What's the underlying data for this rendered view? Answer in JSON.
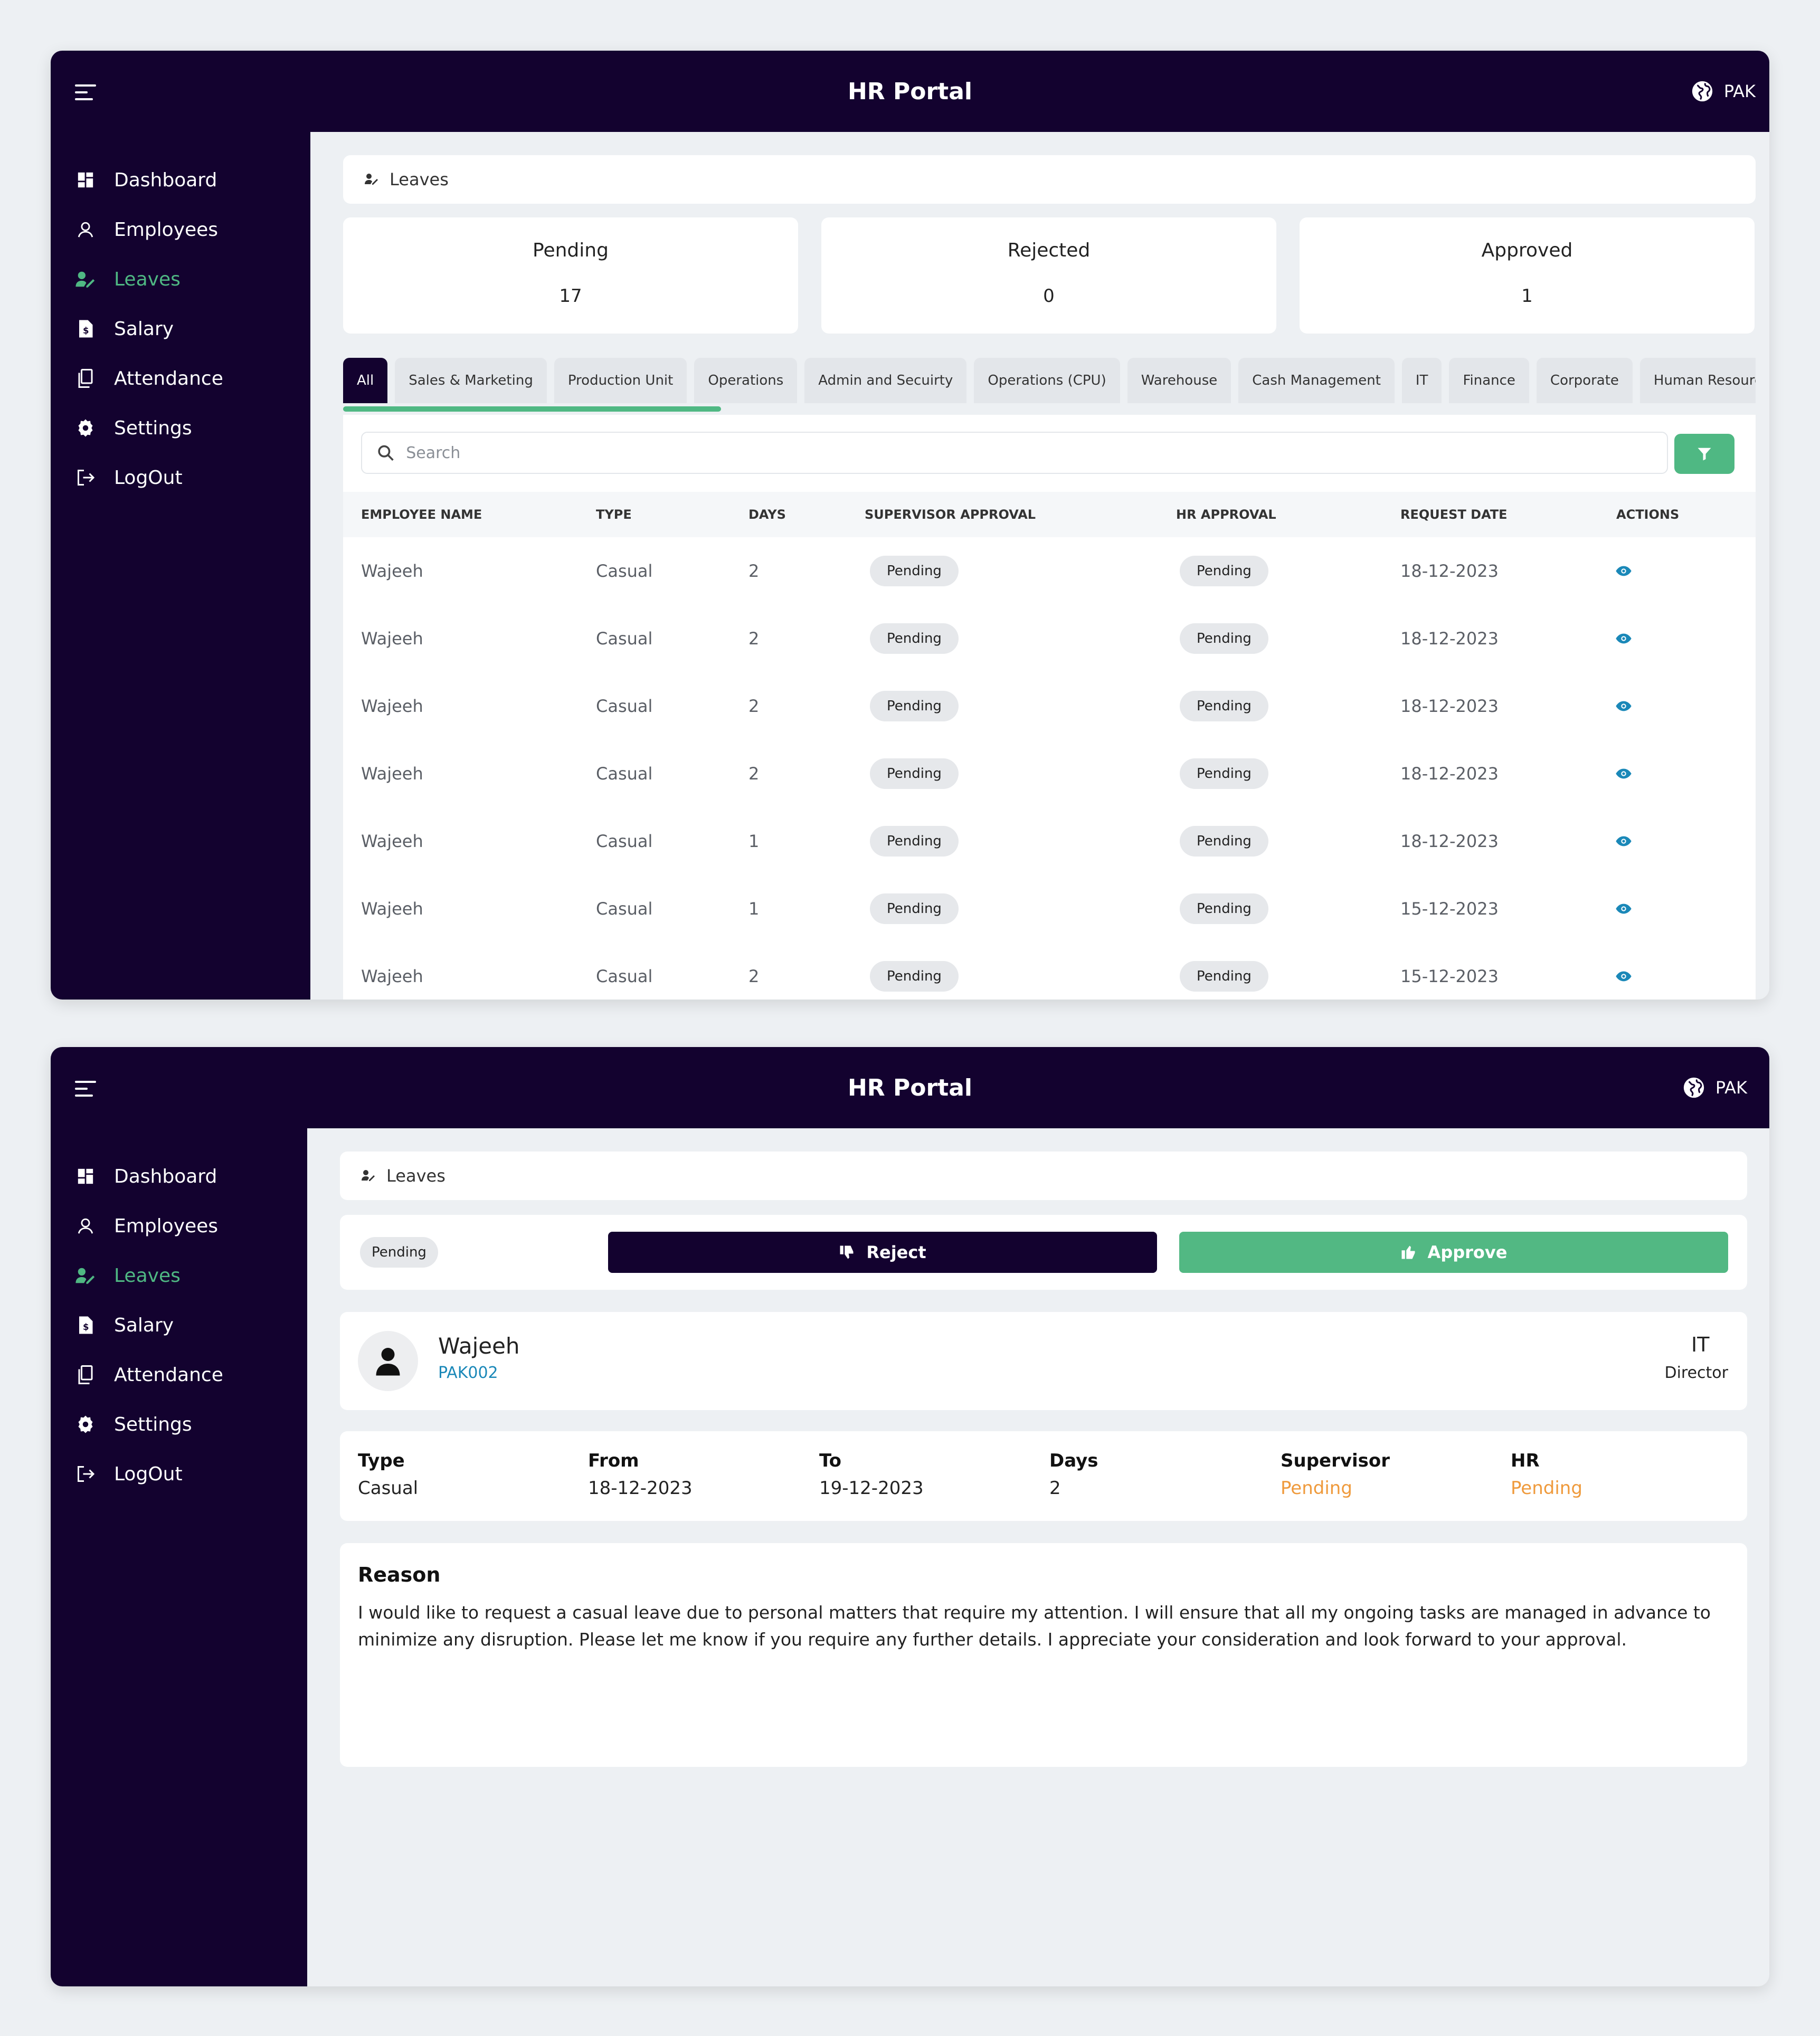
{
  "app": {
    "title": "HR Portal",
    "region": "PAK"
  },
  "sidebar": {
    "items": [
      {
        "label": "Dashboard",
        "icon": "dashboard-icon"
      },
      {
        "label": "Employees",
        "icon": "user-icon"
      },
      {
        "label": "Leaves",
        "icon": "leave-icon"
      },
      {
        "label": "Salary",
        "icon": "salary-icon"
      },
      {
        "label": "Attendance",
        "icon": "attendance-icon"
      },
      {
        "label": "Settings",
        "icon": "gear-icon"
      },
      {
        "label": "LogOut",
        "icon": "logout-icon"
      }
    ],
    "active": "Leaves"
  },
  "breadcrumb": {
    "label": "Leaves"
  },
  "stats": [
    {
      "label": "Pending",
      "value": "17"
    },
    {
      "label": "Rejected",
      "value": "0"
    },
    {
      "label": "Approved",
      "value": "1"
    }
  ],
  "tabs": [
    "All",
    "Sales & Marketing",
    "Production Unit",
    "Operations",
    "Admin and Secuirty",
    "Operations (CPU)",
    "Warehouse",
    "Cash Management",
    "IT",
    "Finance",
    "Corporate",
    "Human Resources"
  ],
  "search": {
    "placeholder": "Search"
  },
  "table": {
    "headers": [
      "EMPLOYEE NAME",
      "TYPE",
      "DAYS",
      "SUPERVISOR APPROVAL",
      "HR APPROVAL",
      "REQUEST DATE",
      "ACTIONS"
    ],
    "rows": [
      [
        "Wajeeh",
        "Casual",
        "2",
        "Pending",
        "Pending",
        "18-12-2023"
      ],
      [
        "Wajeeh",
        "Casual",
        "2",
        "Pending",
        "Pending",
        "18-12-2023"
      ],
      [
        "Wajeeh",
        "Casual",
        "2",
        "Pending",
        "Pending",
        "18-12-2023"
      ],
      [
        "Wajeeh",
        "Casual",
        "2",
        "Pending",
        "Pending",
        "18-12-2023"
      ],
      [
        "Wajeeh",
        "Casual",
        "1",
        "Pending",
        "Pending",
        "18-12-2023"
      ],
      [
        "Wajeeh",
        "Casual",
        "1",
        "Pending",
        "Pending",
        "15-12-2023"
      ],
      [
        "Wajeeh",
        "Casual",
        "2",
        "Pending",
        "Pending",
        "15-12-2023"
      ]
    ]
  },
  "detail": {
    "status": "Pending",
    "reject_label": "Reject",
    "approve_label": "Approve",
    "employee": {
      "name": "Wajeeh",
      "id": "PAK002",
      "department": "IT",
      "role": "Director"
    },
    "fields": [
      {
        "label": "Type",
        "value": "Casual"
      },
      {
        "label": "From",
        "value": "18-12-2023"
      },
      {
        "label": "To",
        "value": "19-12-2023"
      },
      {
        "label": "Days",
        "value": "2"
      },
      {
        "label": "Supervisor",
        "value": "Pending"
      },
      {
        "label": "HR",
        "value": "Pending"
      }
    ],
    "reason_title": "Reason",
    "reason_text": "I would like to request a casual leave due to personal matters that require my attention. I will ensure that all my ongoing tasks are managed in advance to minimize any disruption. Please let me know if you require any further details. I appreciate your consideration and look forward to your approval."
  },
  "colors": {
    "navy": "#13022f",
    "accent_green": "#4fb883",
    "warning_orange": "#ef9a3c",
    "link_blue": "#1a88b8"
  }
}
